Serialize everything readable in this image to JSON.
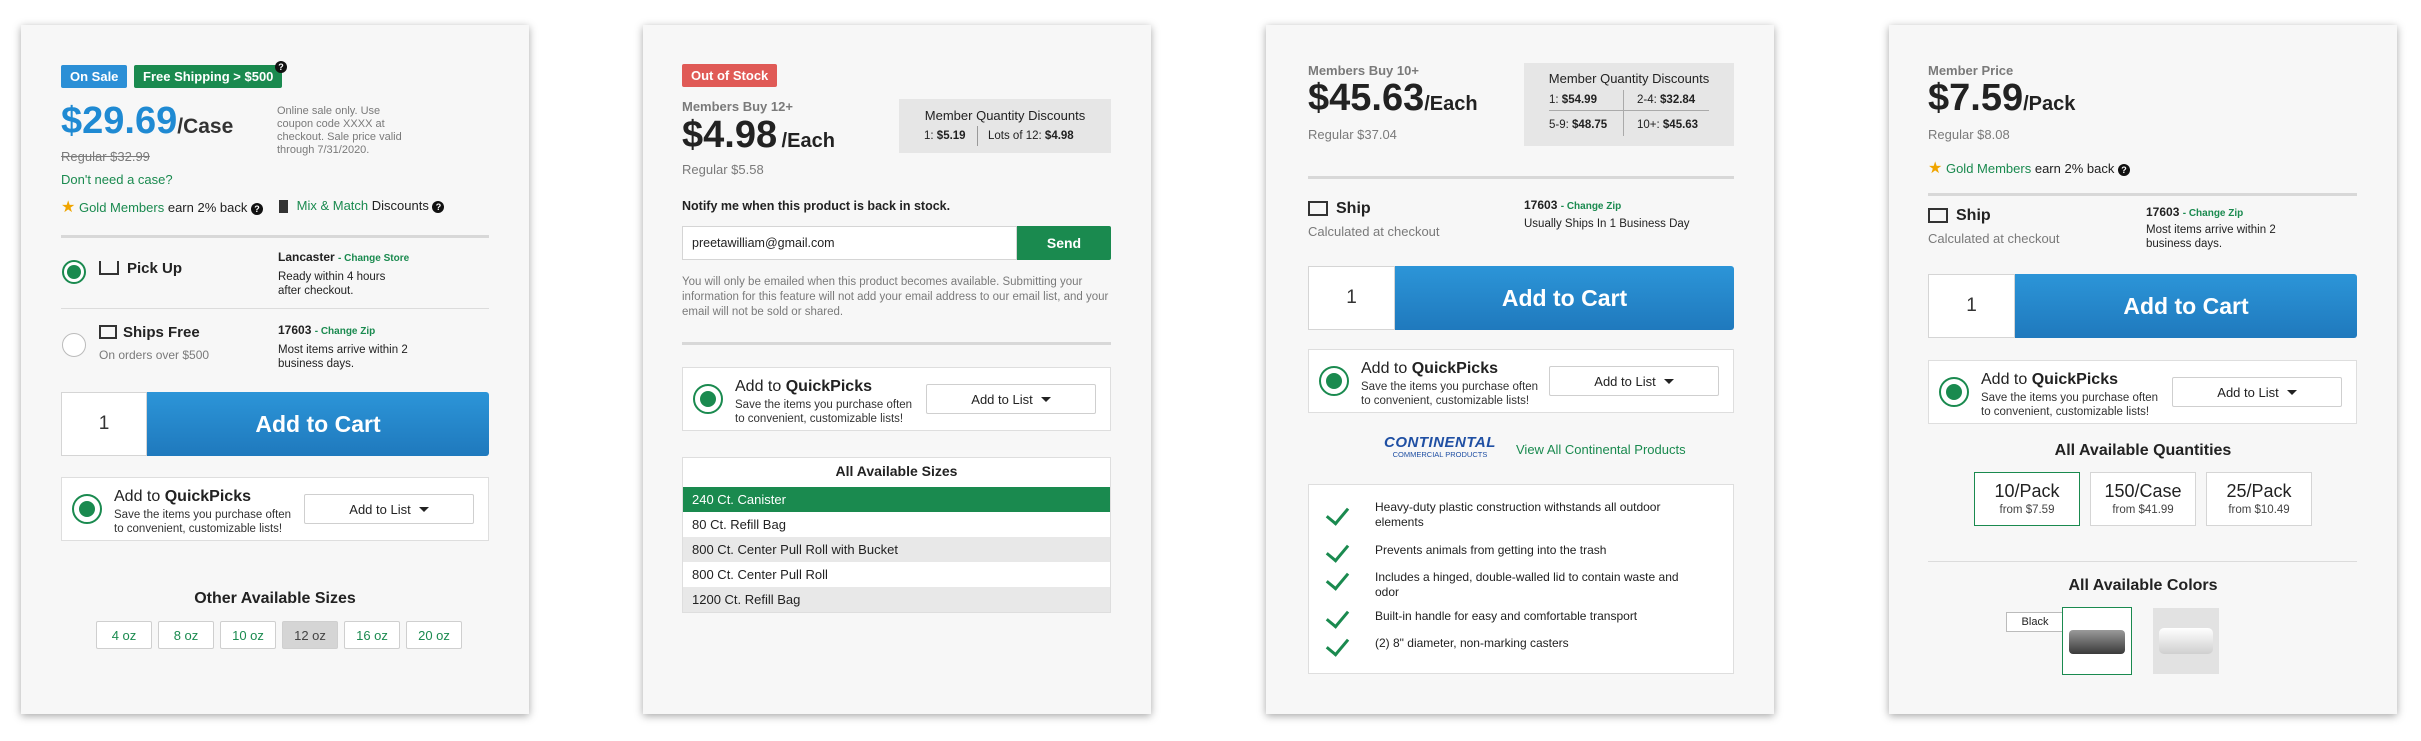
{
  "card1": {
    "badge_sale": "On Sale",
    "badge_shipping": "Free Shipping > $500",
    "price": "$29.69",
    "unit": "/Case",
    "regular": "Regular $32.99",
    "sale_note": "Online sale only. Use coupon code XXXX at checkout. Sale price valid through 7/31/2020.",
    "dont_need_case": "Don't need a case?",
    "gold_members": "Gold Members",
    "earn_back": "earn 2% back",
    "mix_match": "Mix & Match",
    "discounts": "Discounts",
    "pickup_label": "Pick Up",
    "pickup_location": "Lancaster",
    "change_store": "- Change Store",
    "pickup_detail": "Ready within 4 hours after checkout.",
    "ships_free_label": "Ships Free",
    "ships_free_sub": "On orders over $500",
    "zip": "17603",
    "change_zip": "- Change Zip",
    "ship_detail": "Most items arrive within 2 business days.",
    "qty": "1",
    "add_to_cart": "Add to Cart",
    "qp_add_to": "Add to",
    "qp_brand": "QuickPicks",
    "qp_sub": "Save the items you purchase often to convenient, customizable lists!",
    "add_to_list": "Add to List",
    "other_sizes_title": "Other Available Sizes",
    "sizes": [
      "4 oz",
      "8 oz",
      "10 oz",
      "12 oz",
      "16 oz",
      "20 oz"
    ],
    "selected_size": "12 oz"
  },
  "card2": {
    "badge": "Out of Stock",
    "members_buy": "Members Buy 12+",
    "price": "$4.98",
    "unit": "/Each",
    "regular": "Regular $5.58",
    "mqd_title": "Member Quantity Discounts",
    "mqd_1_label": "1:",
    "mqd_1_value": "$5.19",
    "mqd_2_label": "Lots of 12:",
    "mqd_2_value": "$4.98",
    "notify": "Notify me when this product is back in stock.",
    "email": "preetawilliam@gmail.com",
    "send": "Send",
    "disclaimer": "You will only be emailed when this product becomes available. Submitting your information for this feature will not add your email address to our email list, and your email will not be sold or shared.",
    "qp_add_to": "Add to",
    "qp_brand": "QuickPicks",
    "qp_sub": "Save the items you purchase often to convenient, customizable lists!",
    "add_to_list": "Add to List",
    "sizes_title": "All Available Sizes",
    "sizes": [
      "240 Ct. Canister",
      "80 Ct. Refill Bag",
      "800 Ct. Center Pull Roll with Bucket",
      "800 Ct. Center Pull Roll",
      "1200 Ct. Refill Bag"
    ]
  },
  "card3": {
    "members_buy": "Members Buy 10+",
    "price": "$45.63",
    "unit": "/Each",
    "regular": "Regular $37.04",
    "mqd_title": "Member Quantity Discounts",
    "mqd": [
      {
        "label": "1:",
        "value": "$54.99"
      },
      {
        "label": "2-4:",
        "value": "$32.84"
      },
      {
        "label": "5-9:",
        "value": "$48.75"
      },
      {
        "label": "10+:",
        "value": "$45.63"
      }
    ],
    "ship_label": "Ship",
    "ship_sub": "Calculated at checkout",
    "zip": "17603",
    "change_zip": "- Change Zip",
    "ship_detail": "Usually Ships In 1 Business Day",
    "qty": "1",
    "add_to_cart": "Add to Cart",
    "qp_add_to": "Add to",
    "qp_brand": "QuickPicks",
    "qp_sub": "Save the items you purchase often to convenient, customizable lists!",
    "add_to_list": "Add to List",
    "brand_logo": "CONTINENTAL",
    "brand_logo_sub": "COMMERCIAL PRODUCTS",
    "view_all": "View All Continental Products",
    "features": [
      "Heavy-duty plastic construction withstands all outdoor elements",
      "Prevents animals from getting into the trash",
      "Includes a hinged, double-walled lid to contain waste and odor",
      "Built-in handle for easy and comfortable transport",
      "(2) 8\" diameter, non-marking casters"
    ]
  },
  "card4": {
    "member_price": "Member Price",
    "price": "$7.59",
    "unit": "/Pack",
    "regular": "Regular $8.08",
    "gold_members": "Gold Members",
    "earn_back": "earn 2% back",
    "ship_label": "Ship",
    "ship_sub": "Calculated at checkout",
    "zip": "17603",
    "change_zip": "- Change Zip",
    "ship_detail": "Most items arrive within 2 business days.",
    "qty": "1",
    "add_to_cart": "Add to Cart",
    "qp_add_to": "Add to",
    "qp_brand": "QuickPicks",
    "qp_sub": "Save the items you purchase often to convenient, customizable lists!",
    "add_to_list": "Add to List",
    "quantities_title": "All Available Quantities",
    "quantities": [
      {
        "title": "10/Pack",
        "sub": "from $7.59"
      },
      {
        "title": "150/Case",
        "sub": "from $41.99"
      },
      {
        "title": "25/Pack",
        "sub": "from $10.49"
      }
    ],
    "colors_title": "All Available Colors",
    "color_tooltip": "Black"
  },
  "icons": [
    "help-icon",
    "star-icon",
    "cart-icon",
    "truck-icon",
    "quickpicks-icon",
    "check-icon",
    "chevron-down-icon",
    "mix-match-icon"
  ],
  "colors": {
    "accent_blue": "#1f8ad3",
    "accent_green": "#1a8a4f",
    "sale_badge": "#2b8fd6",
    "out_of_stock": "#e05a56"
  }
}
